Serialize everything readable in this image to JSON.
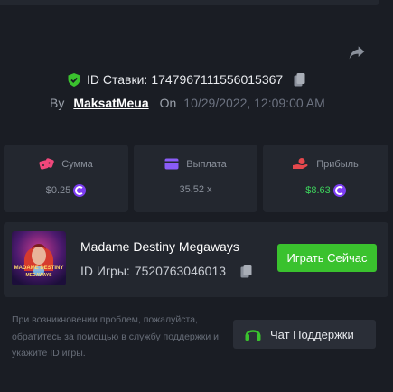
{
  "bet": {
    "id_label": "ID Ставки:",
    "id_value": "1747967111556015367",
    "by_label": "By",
    "username": "MaksatMeua",
    "on_label": "On",
    "date": "10/29/2022, 12:09:00 AM"
  },
  "stats": {
    "amount": {
      "label": "Сумма",
      "value": "$0.25"
    },
    "payout": {
      "label": "Выплата",
      "value": "35.52 x"
    },
    "profit": {
      "label": "Прибыль",
      "value": "$8.63"
    }
  },
  "game": {
    "name": "Madame Destiny Megaways",
    "id_label": "ID Игры:",
    "id_value": "7520763046013",
    "play_label": "Играть Сейчас",
    "thumb_text_1": "MADAME DESTINY",
    "thumb_text_2": "MEGAWAYS"
  },
  "support": {
    "help_text": "При возникновении проблем, пожалуйста, обратитесь за помощью в службу поддержки и укажите ID игры.",
    "chat_label": "Чат Поддержки"
  },
  "colors": {
    "background": "#1a1d24",
    "panel": "#23272f",
    "accent_green": "#3ac22e",
    "profit_green": "#3dd35c",
    "coin_purple": "#7d3df2",
    "bet_icon_pink": "#f0477b",
    "payout_icon_purple": "#8a5cf6",
    "profit_icon_red": "#e5484d"
  },
  "icons": {
    "share": "share-icon",
    "verified": "shield-check-icon",
    "copy": "copy-icon",
    "amount": "dice-icon",
    "payout": "wallet-icon",
    "profit": "hand-coin-icon",
    "currency": "coin-icon",
    "chat": "headset-icon"
  }
}
